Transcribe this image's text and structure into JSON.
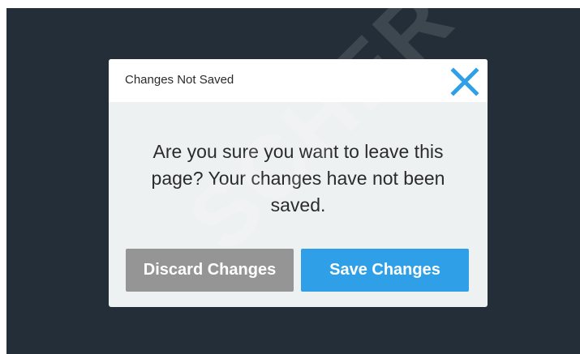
{
  "dialog": {
    "title": "Changes Not Saved",
    "message": "Are you sure you want to leave this page? Your changes have not been saved.",
    "close_icon": "close-x-icon",
    "discard_label": "Discard Changes",
    "save_label": "Save Changes"
  },
  "watermark": {
    "text": "SCHER"
  },
  "colors": {
    "backdrop": "#232e38",
    "dialog_body": "#eef1f2",
    "dialog_header": "#ffffff",
    "accent": "#2f9fe7",
    "discard_button": "#959595"
  }
}
